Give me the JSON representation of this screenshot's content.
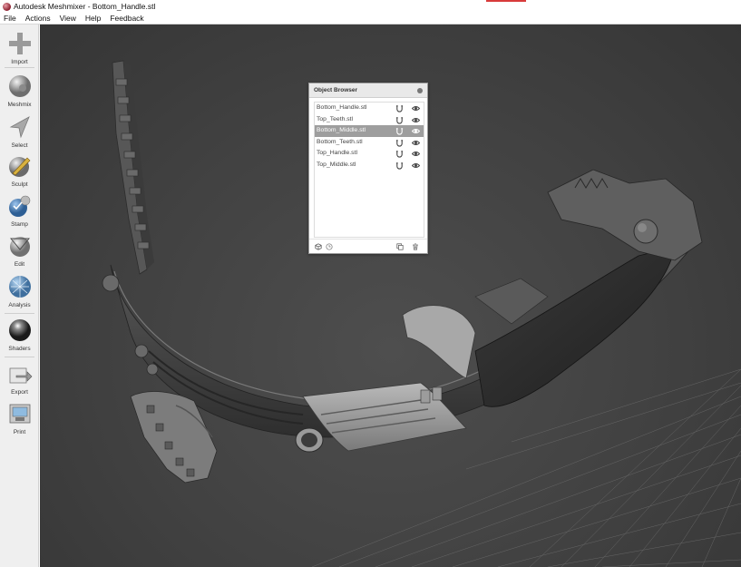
{
  "window": {
    "title": "Autodesk Meshmixer - Bottom_Handle.stl"
  },
  "menu": {
    "items": [
      "File",
      "Actions",
      "View",
      "Help",
      "Feedback"
    ]
  },
  "toolbar": {
    "tools": [
      {
        "label": "Import",
        "icon": "plus-icon"
      },
      {
        "label": "Meshmix",
        "icon": "meshmix-sphere-icon"
      },
      {
        "label": "Select",
        "icon": "arrow-cursor-icon"
      },
      {
        "label": "Sculpt",
        "icon": "brush-icon"
      },
      {
        "label": "Stamp",
        "icon": "stamp-icon"
      },
      {
        "label": "Edit",
        "icon": "edit-sphere-icon"
      },
      {
        "label": "Analysis",
        "icon": "analysis-sphere-icon"
      },
      {
        "label": "Shaders",
        "icon": "shader-ball-icon"
      },
      {
        "label": "Export",
        "icon": "export-icon"
      },
      {
        "label": "Print",
        "icon": "printer-icon"
      }
    ]
  },
  "object_browser": {
    "title": "Object Browser",
    "objects": [
      {
        "name": "Bottom_Handle.stl",
        "selected": false
      },
      {
        "name": "Top_Teeth.stl",
        "selected": false
      },
      {
        "name": "Bottom_Middle.stl",
        "selected": true
      },
      {
        "name": "Bottom_Teeth.stl",
        "selected": false
      },
      {
        "name": "Top_Handle.stl",
        "selected": false
      },
      {
        "name": "Top_Middle.stl",
        "selected": false
      }
    ]
  },
  "colors": {
    "accent": "#d83b3b",
    "viewport_bg": "#414141",
    "selected_row": "#9e9e9e"
  }
}
